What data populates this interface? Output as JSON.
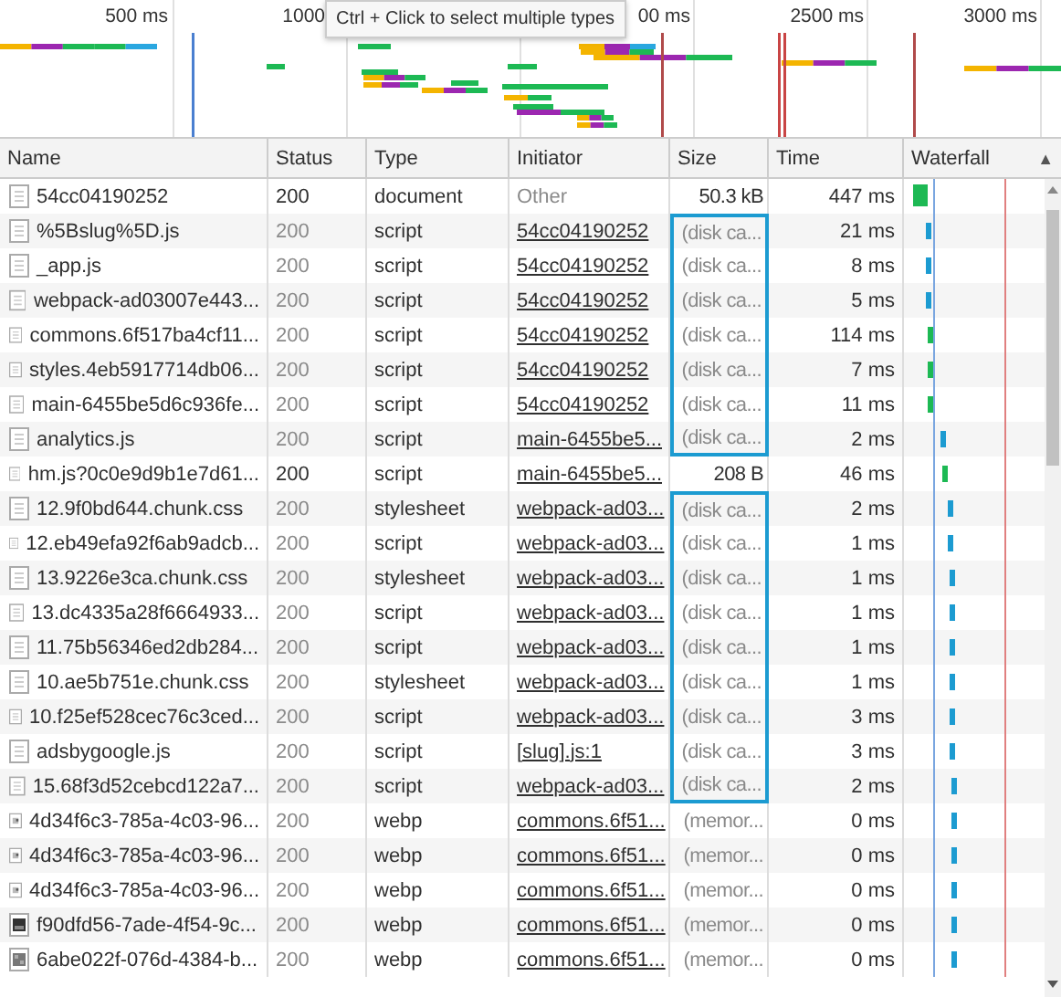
{
  "overview": {
    "ticks": [
      "500 ms",
      "1000",
      "00 ms",
      "2500 ms",
      "3000 ms"
    ],
    "tooltip": "Ctrl + Click to select multiple types"
  },
  "table": {
    "columns": [
      "Name",
      "Status",
      "Type",
      "Initiator",
      "Size",
      "Time",
      "Waterfall"
    ],
    "sort_indicator": "▲",
    "rows": [
      {
        "kind": "file",
        "name": "54cc04190252",
        "status": "200",
        "type": "document",
        "initiator": "Other",
        "initiator_link": false,
        "size": "50.3 kB",
        "cached": false,
        "boxed": false,
        "time": "447 ms"
      },
      {
        "kind": "file",
        "name": "%5Bslug%5D.js",
        "status": "200",
        "type": "script",
        "initiator": "54cc04190252",
        "initiator_link": true,
        "size": "(disk ca...",
        "cached": true,
        "boxed": true,
        "time": "21 ms"
      },
      {
        "kind": "file",
        "name": "_app.js",
        "status": "200",
        "type": "script",
        "initiator": "54cc04190252",
        "initiator_link": true,
        "size": "(disk ca...",
        "cached": true,
        "boxed": true,
        "time": "8 ms"
      },
      {
        "kind": "file",
        "name": "webpack-ad03007e443...",
        "status": "200",
        "type": "script",
        "initiator": "54cc04190252",
        "initiator_link": true,
        "size": "(disk ca...",
        "cached": true,
        "boxed": true,
        "time": "5 ms"
      },
      {
        "kind": "file",
        "name": "commons.6f517ba4cf11...",
        "status": "200",
        "type": "script",
        "initiator": "54cc04190252",
        "initiator_link": true,
        "size": "(disk ca...",
        "cached": true,
        "boxed": true,
        "time": "114 ms"
      },
      {
        "kind": "file",
        "name": "styles.4eb5917714db06...",
        "status": "200",
        "type": "script",
        "initiator": "54cc04190252",
        "initiator_link": true,
        "size": "(disk ca...",
        "cached": true,
        "boxed": true,
        "time": "7 ms"
      },
      {
        "kind": "file",
        "name": "main-6455be5d6c936fe...",
        "status": "200",
        "type": "script",
        "initiator": "54cc04190252",
        "initiator_link": true,
        "size": "(disk ca...",
        "cached": true,
        "boxed": true,
        "time": "11 ms"
      },
      {
        "kind": "file",
        "name": "analytics.js",
        "status": "200",
        "type": "script",
        "initiator": "main-6455be5...",
        "initiator_link": true,
        "size": "(disk ca...",
        "cached": true,
        "boxed": true,
        "time": "2 ms"
      },
      {
        "kind": "file",
        "name": "hm.js?0c0e9d9b1e7d61...",
        "status": "200",
        "type": "script",
        "initiator": "main-6455be5...",
        "initiator_link": true,
        "size": "208 B",
        "cached": false,
        "boxed": false,
        "time": "46 ms"
      },
      {
        "kind": "file",
        "name": "12.9f0bd644.chunk.css",
        "status": "200",
        "type": "stylesheet",
        "initiator": "webpack-ad03...",
        "initiator_link": true,
        "size": "(disk ca...",
        "cached": true,
        "boxed": true,
        "time": "2 ms"
      },
      {
        "kind": "file",
        "name": "12.eb49efa92f6ab9adcb...",
        "status": "200",
        "type": "script",
        "initiator": "webpack-ad03...",
        "initiator_link": true,
        "size": "(disk ca...",
        "cached": true,
        "boxed": true,
        "time": "1 ms"
      },
      {
        "kind": "file",
        "name": "13.9226e3ca.chunk.css",
        "status": "200",
        "type": "stylesheet",
        "initiator": "webpack-ad03...",
        "initiator_link": true,
        "size": "(disk ca...",
        "cached": true,
        "boxed": true,
        "time": "1 ms"
      },
      {
        "kind": "file",
        "name": "13.dc4335a28f6664933...",
        "status": "200",
        "type": "script",
        "initiator": "webpack-ad03...",
        "initiator_link": true,
        "size": "(disk ca...",
        "cached": true,
        "boxed": true,
        "time": "1 ms"
      },
      {
        "kind": "file",
        "name": "11.75b56346ed2db284...",
        "status": "200",
        "type": "script",
        "initiator": "webpack-ad03...",
        "initiator_link": true,
        "size": "(disk ca...",
        "cached": true,
        "boxed": true,
        "time": "1 ms"
      },
      {
        "kind": "file",
        "name": "10.ae5b751e.chunk.css",
        "status": "200",
        "type": "stylesheet",
        "initiator": "webpack-ad03...",
        "initiator_link": true,
        "size": "(disk ca...",
        "cached": true,
        "boxed": true,
        "time": "1 ms"
      },
      {
        "kind": "file",
        "name": "10.f25ef528cec76c3ced...",
        "status": "200",
        "type": "script",
        "initiator": "webpack-ad03...",
        "initiator_link": true,
        "size": "(disk ca...",
        "cached": true,
        "boxed": true,
        "time": "3 ms"
      },
      {
        "kind": "file",
        "name": "adsbygoogle.js",
        "status": "200",
        "type": "script",
        "initiator": "[slug].js:1",
        "initiator_link": true,
        "size": "(disk ca...",
        "cached": true,
        "boxed": true,
        "time": "3 ms"
      },
      {
        "kind": "file",
        "name": "15.68f3d52cebcd122a7...",
        "status": "200",
        "type": "script",
        "initiator": "webpack-ad03...",
        "initiator_link": true,
        "size": "(disk ca...",
        "cached": true,
        "boxed": true,
        "time": "2 ms"
      },
      {
        "kind": "image",
        "name": "4d34f6c3-785a-4c03-96...",
        "status": "200",
        "type": "webp",
        "initiator": "commons.6f51...",
        "initiator_link": true,
        "size": "(memor...",
        "cached": true,
        "boxed": false,
        "time": "0 ms"
      },
      {
        "kind": "image",
        "name": "4d34f6c3-785a-4c03-96...",
        "status": "200",
        "type": "webp",
        "initiator": "commons.6f51...",
        "initiator_link": true,
        "size": "(memor...",
        "cached": true,
        "boxed": false,
        "time": "0 ms"
      },
      {
        "kind": "image",
        "name": "4d34f6c3-785a-4c03-96...",
        "status": "200",
        "type": "webp",
        "initiator": "commons.6f51...",
        "initiator_link": true,
        "size": "(memor...",
        "cached": true,
        "boxed": false,
        "time": "0 ms"
      },
      {
        "kind": "photo",
        "name": "f90dfd56-7ade-4f54-9c...",
        "status": "200",
        "type": "webp",
        "initiator": "commons.6f51...",
        "initiator_link": true,
        "size": "(memor...",
        "cached": true,
        "boxed": false,
        "time": "0 ms"
      },
      {
        "kind": "mosaic",
        "name": "6abe022f-076d-4384-b...",
        "status": "200",
        "type": "webp",
        "initiator": "commons.6f51...",
        "initiator_link": true,
        "size": "(memor...",
        "cached": true,
        "boxed": false,
        "time": "0 ms"
      }
    ]
  }
}
